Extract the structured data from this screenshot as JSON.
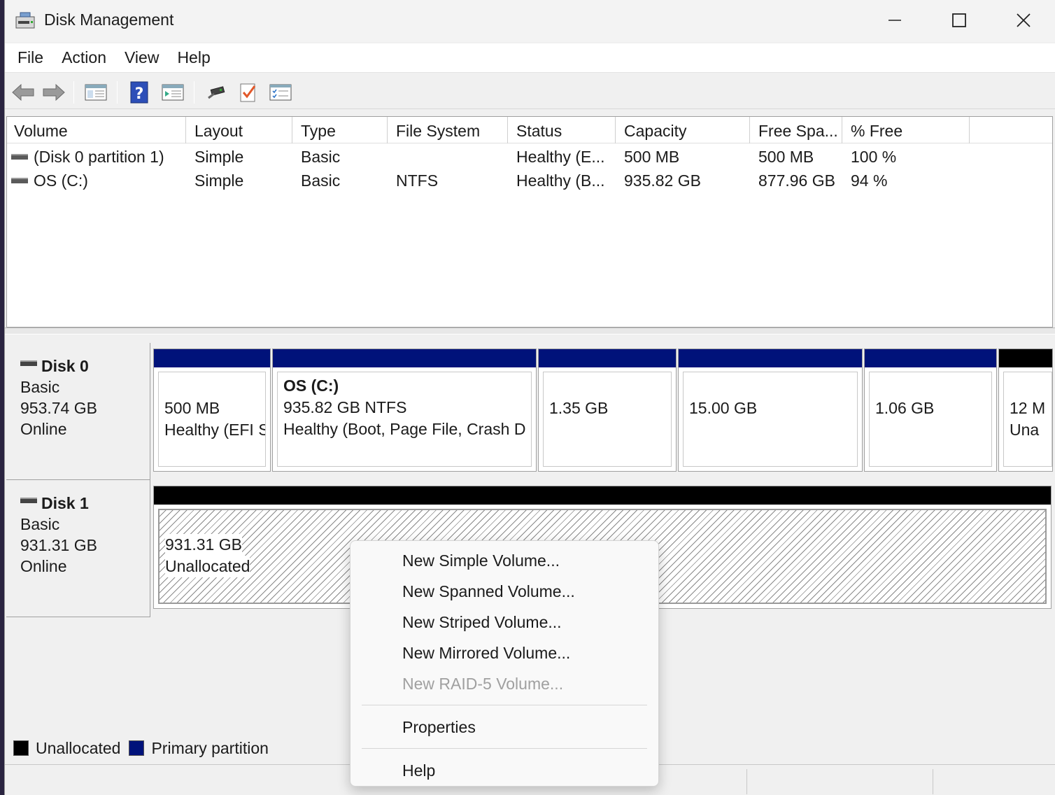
{
  "window": {
    "title": "Disk Management",
    "icons": {
      "app": "disk-management-icon",
      "minimize": "minimize-icon",
      "maximize": "maximize-icon",
      "close": "close-icon"
    }
  },
  "menubar": {
    "items": [
      "File",
      "Action",
      "View",
      "Help"
    ]
  },
  "toolbar": {
    "buttons": [
      "back-arrow-icon",
      "forward-arrow-icon",
      "show-hide-console-tree-icon",
      "help-icon",
      "show-hide-action-pane-icon",
      "connect-icon",
      "check-icon",
      "properties-list-icon"
    ]
  },
  "volume_list": {
    "columns": [
      "Volume",
      "Layout",
      "Type",
      "File System",
      "Status",
      "Capacity",
      "Free Spa...",
      "% Free"
    ],
    "rows": [
      {
        "volume": "(Disk 0 partition 1)",
        "layout": "Simple",
        "type": "Basic",
        "fs": "",
        "status": "Healthy (E...",
        "capacity": "500 MB",
        "free": "500 MB",
        "pct": "100 %"
      },
      {
        "volume": "OS (C:)",
        "layout": "Simple",
        "type": "Basic",
        "fs": "NTFS",
        "status": "Healthy (B...",
        "capacity": "935.82 GB",
        "free": "877.96 GB",
        "pct": "94 %"
      }
    ]
  },
  "disks": [
    {
      "name": "Disk 0",
      "type": "Basic",
      "size": "953.74 GB",
      "state": "Online",
      "partitions": [
        {
          "title": "",
          "line1": "500 MB",
          "line2": "Healthy (EFI S"
        },
        {
          "title": "OS  (C:)",
          "line1": "935.82 GB NTFS",
          "line2": "Healthy (Boot, Page File, Crash D"
        },
        {
          "title": "",
          "line1": "1.35 GB",
          "line2": ""
        },
        {
          "title": "",
          "line1": "15.00 GB",
          "line2": ""
        },
        {
          "title": "",
          "line1": "1.06 GB",
          "line2": ""
        },
        {
          "title": "",
          "line1": "12 M",
          "line2": "Una"
        }
      ]
    },
    {
      "name": "Disk 1",
      "type": "Basic",
      "size": "931.31 GB",
      "state": "Online",
      "partitions": [
        {
          "line1": "931.31 GB",
          "line2": "Unallocated"
        }
      ]
    }
  ],
  "legend": [
    {
      "label": "Unallocated",
      "color": "#000000"
    },
    {
      "label": "Primary partition",
      "color": "#00127a"
    }
  ],
  "context_menu": {
    "items": [
      {
        "label": "New Simple Volume...",
        "enabled": true
      },
      {
        "label": "New Spanned Volume...",
        "enabled": true
      },
      {
        "label": "New Striped Volume...",
        "enabled": true
      },
      {
        "label": "New Mirrored Volume...",
        "enabled": true
      },
      {
        "label": "New RAID-5 Volume...",
        "enabled": false
      },
      {
        "label": "Properties",
        "enabled": true
      },
      {
        "label": "Help",
        "enabled": true
      }
    ]
  },
  "colors": {
    "primary_partition": "#00127a",
    "unallocated": "#000000"
  }
}
